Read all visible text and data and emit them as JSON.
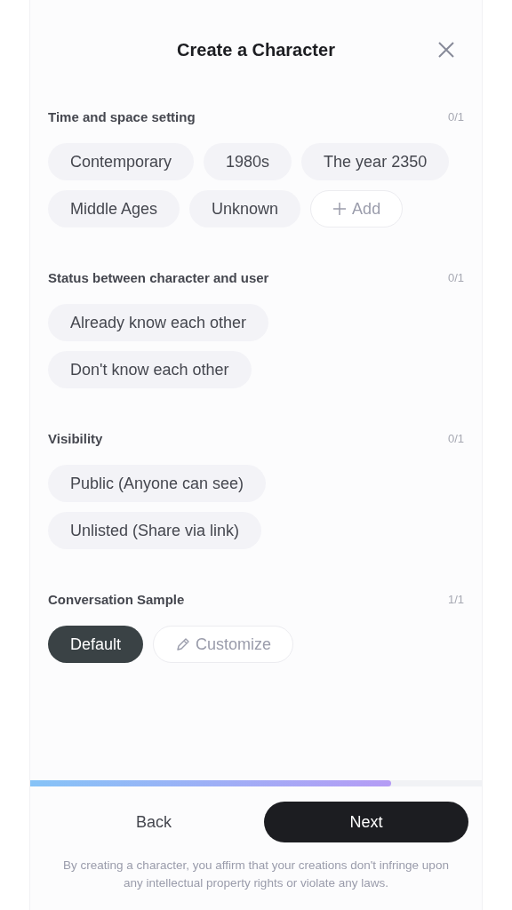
{
  "header": {
    "title": "Create a Character"
  },
  "sections": [
    {
      "heading": "Time and space setting",
      "count": "0/1",
      "chips": [
        {
          "label": "Contemporary",
          "kind": "option",
          "selected": false
        },
        {
          "label": "1980s",
          "kind": "option",
          "selected": false
        },
        {
          "label": "The year 2350",
          "kind": "option",
          "selected": false
        },
        {
          "label": "Middle Ages",
          "kind": "option",
          "selected": false
        },
        {
          "label": "Unknown",
          "kind": "option",
          "selected": false
        },
        {
          "label": "Add",
          "kind": "add",
          "selected": false
        }
      ]
    },
    {
      "heading": "Status between character and user",
      "count": "0/1",
      "chips": [
        {
          "label": "Already know each other",
          "kind": "option",
          "selected": false
        },
        {
          "label": "Don't know each other",
          "kind": "option",
          "selected": false
        }
      ]
    },
    {
      "heading": "Visibility",
      "count": "0/1",
      "chips": [
        {
          "label": "Public (Anyone can see)",
          "kind": "option",
          "selected": false
        },
        {
          "label": "Unlisted (Share via link)",
          "kind": "option",
          "selected": false
        }
      ]
    },
    {
      "heading": "Conversation Sample",
      "count": "1/1",
      "chips": [
        {
          "label": "Default",
          "kind": "option",
          "selected": true
        },
        {
          "label": "Customize",
          "kind": "edit",
          "selected": false
        }
      ]
    }
  ],
  "progress": {
    "level": 0.8
  },
  "footer": {
    "back": "Back",
    "next": "Next",
    "notice": "By creating a character, you affirm that your creations don't infringe upon any intellectual property rights or violate any laws."
  }
}
